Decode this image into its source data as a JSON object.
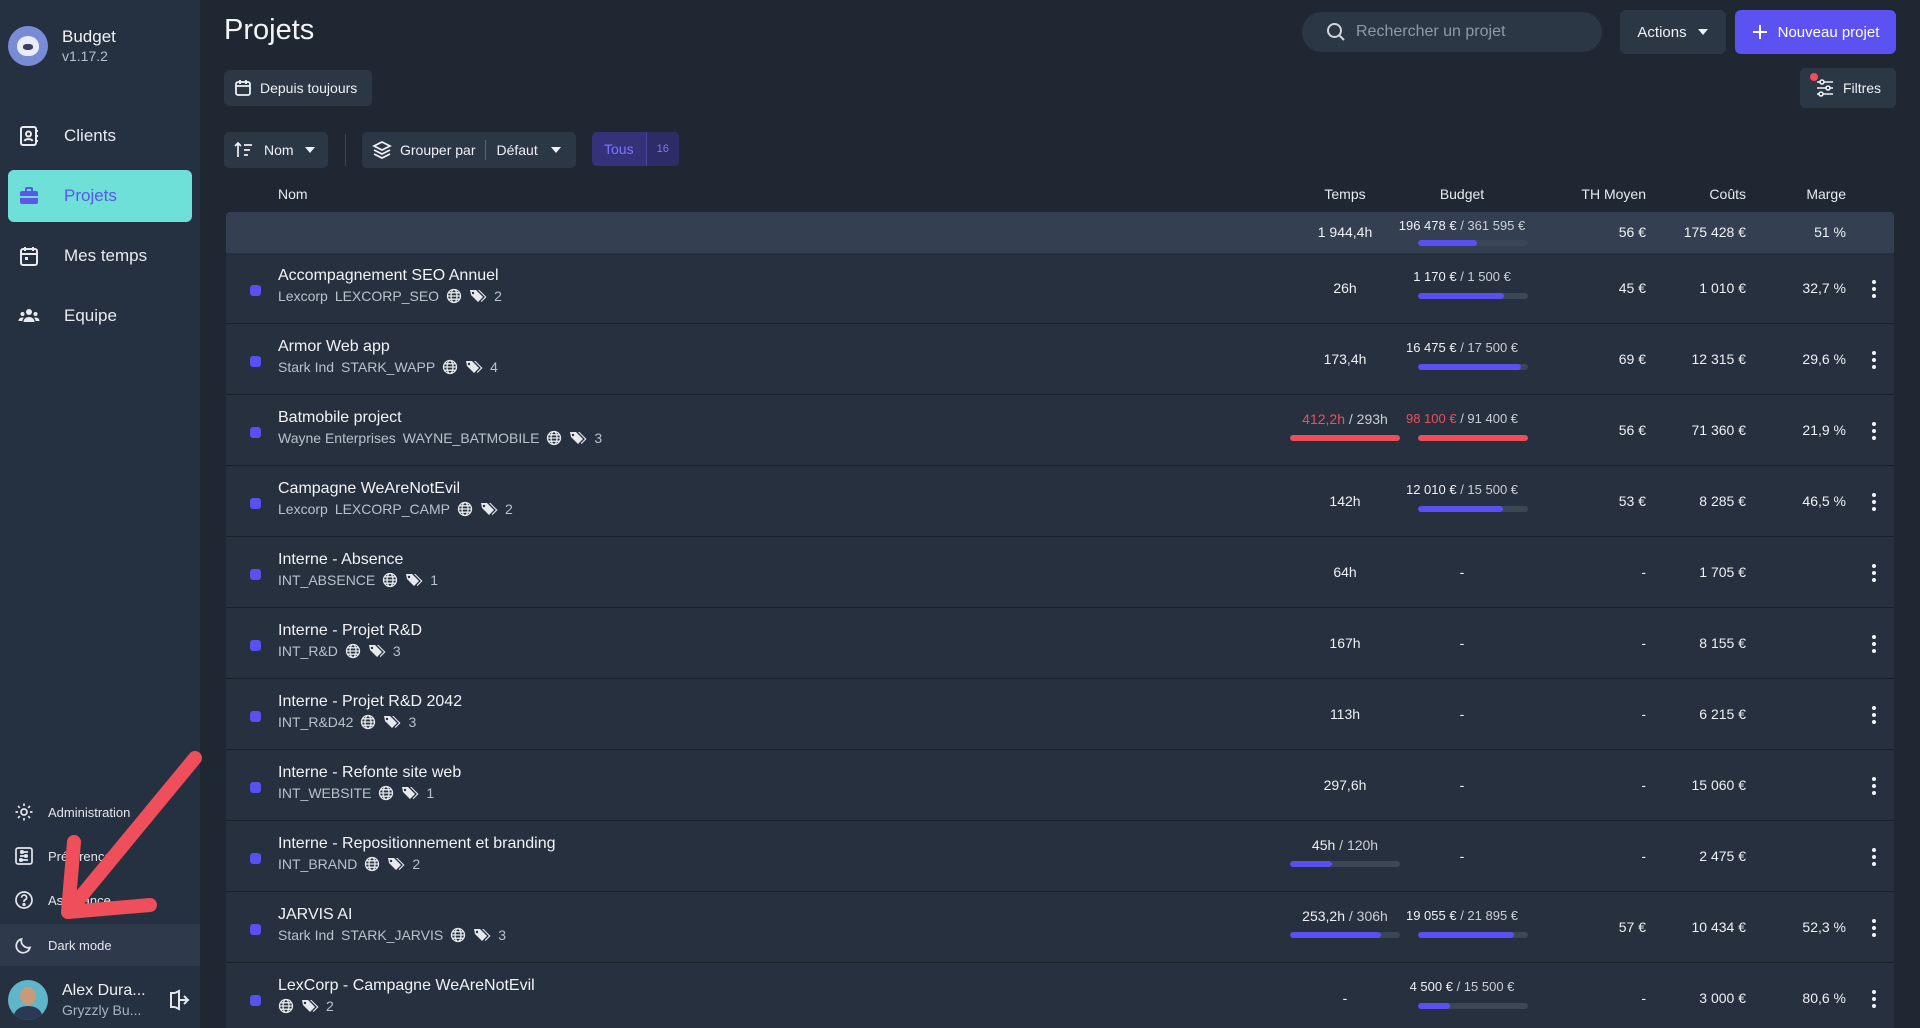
{
  "brand": {
    "name": "Budget",
    "version": "v1.17.2"
  },
  "nav": [
    {
      "label": "Clients",
      "icon": "contacts-book-icon",
      "active": false
    },
    {
      "label": "Projets",
      "icon": "briefcase-icon",
      "active": true
    },
    {
      "label": "Mes temps",
      "icon": "calendar-icon",
      "active": false
    },
    {
      "label": "Equipe",
      "icon": "team-icon",
      "active": false
    }
  ],
  "bottom_nav": {
    "administration": "Administration",
    "preferences": "Préférences",
    "assistance": "Assistance",
    "dark_mode": "Dark mode"
  },
  "user": {
    "name": "Alex Dura...",
    "org": "Gryzzly Bu..."
  },
  "header": {
    "title": "Projets",
    "search_placeholder": "Rechercher un projet",
    "actions_label": "Actions",
    "new_project_label": "Nouveau projet",
    "period_label": "Depuis toujours",
    "filters_label": "Filtres"
  },
  "toolbar": {
    "sort_label": "Nom",
    "group_by_label": "Grouper par",
    "group_by_value": "Défaut",
    "all_label": "Tous",
    "all_count": "16"
  },
  "columns": {
    "name": "Nom",
    "time": "Temps",
    "budget": "Budget",
    "th": "TH Moyen",
    "costs": "Coûts",
    "margin": "Marge"
  },
  "totals": {
    "time": "1 944,4h",
    "budget_spent": "196 478 €",
    "budget_total": "361 595 €",
    "budget_progress": 0.54,
    "th": "56 €",
    "costs": "175 428 €",
    "margin": "51 %"
  },
  "projects": [
    {
      "name": "Accompagnement SEO Annuel",
      "client": "Lexcorp",
      "code": "LEXCORP_SEO",
      "tags": "2",
      "time": "26h",
      "time_budget": null,
      "time_progress": null,
      "time_over": false,
      "budget_spent": "1 170 €",
      "budget_total": "1 500 €",
      "budget_progress": 0.78,
      "budget_over": false,
      "th": "45 €",
      "costs": "1 010 €",
      "margin": "32,7 %"
    },
    {
      "name": "Armor Web app",
      "client": "Stark Ind",
      "code": "STARK_WAPP",
      "tags": "4",
      "time": "173,4h",
      "time_budget": null,
      "time_progress": null,
      "time_over": false,
      "budget_spent": "16 475 €",
      "budget_total": "17 500 €",
      "budget_progress": 0.94,
      "budget_over": false,
      "th": "69 €",
      "costs": "12 315 €",
      "margin": "29,6 %"
    },
    {
      "name": "Batmobile project",
      "client": "Wayne Enterprises",
      "code": "WAYNE_BATMOBILE",
      "tags": "3",
      "time": "412,2h",
      "time_budget": "293h",
      "time_progress": 1.0,
      "time_over": true,
      "budget_spent": "98 100 €",
      "budget_total": "91 400 €",
      "budget_progress": 1.0,
      "budget_over": true,
      "th": "56 €",
      "costs": "71 360 €",
      "margin": "21,9 %"
    },
    {
      "name": "Campagne WeAreNotEvil",
      "client": "Lexcorp",
      "code": "LEXCORP_CAMP",
      "tags": "2",
      "time": "142h",
      "time_budget": null,
      "time_progress": null,
      "time_over": false,
      "budget_spent": "12 010 €",
      "budget_total": "15 500 €",
      "budget_progress": 0.77,
      "budget_over": false,
      "th": "53 €",
      "costs": "8 285 €",
      "margin": "46,5 %"
    },
    {
      "name": "Interne - Absence",
      "client": "",
      "code": "INT_ABSENCE",
      "tags": "1",
      "time": "64h",
      "time_budget": null,
      "time_progress": null,
      "time_over": false,
      "budget_text": "-",
      "th": "-",
      "costs": "1 705 €",
      "margin": ""
    },
    {
      "name": "Interne - Projet R&D",
      "client": "",
      "code": "INT_R&D",
      "tags": "3",
      "time": "167h",
      "time_budget": null,
      "time_progress": null,
      "time_over": false,
      "budget_text": "-",
      "th": "-",
      "costs": "8 155 €",
      "margin": ""
    },
    {
      "name": "Interne - Projet R&D 2042",
      "client": "",
      "code": "INT_R&D42",
      "tags": "3",
      "time": "113h",
      "time_budget": null,
      "time_progress": null,
      "time_over": false,
      "budget_text": "-",
      "th": "-",
      "costs": "6 215 €",
      "margin": ""
    },
    {
      "name": "Interne - Refonte site web",
      "client": "",
      "code": "INT_WEBSITE",
      "tags": "1",
      "time": "297,6h",
      "time_budget": null,
      "time_progress": null,
      "time_over": false,
      "budget_text": "-",
      "th": "-",
      "costs": "15 060 €",
      "margin": ""
    },
    {
      "name": "Interne - Repositionnement et branding",
      "client": "",
      "code": "INT_BRAND",
      "tags": "2",
      "time": "45h",
      "time_budget": "120h",
      "time_progress": 0.38,
      "time_over": false,
      "budget_text": "-",
      "th": "-",
      "costs": "2 475 €",
      "margin": ""
    },
    {
      "name": "JARVIS AI",
      "client": "Stark Ind",
      "code": "STARK_JARVIS",
      "tags": "3",
      "time": "253,2h",
      "time_budget": "306h",
      "time_progress": 0.83,
      "time_over": false,
      "budget_spent": "19 055 €",
      "budget_total": "21 895 €",
      "budget_progress": 0.87,
      "budget_over": false,
      "th": "57 €",
      "costs": "10 434 €",
      "margin": "52,3 %"
    },
    {
      "name": "LexCorp - Campagne WeAreNotEvil",
      "client": "",
      "code": "",
      "tags": "2",
      "time": "-",
      "time_budget": null,
      "time_progress": null,
      "time_over": false,
      "budget_spent": "4 500 €",
      "budget_total": "15 500 €",
      "budget_progress": 0.29,
      "budget_over": false,
      "th": "-",
      "costs": "3 000 €",
      "margin": "80,6 %"
    }
  ],
  "colors": {
    "accent": "#5c52f2",
    "active_nav": "#6ee0d8",
    "danger": "#ef4e5b",
    "background": "#1f2733",
    "sidebar": "#253040"
  }
}
